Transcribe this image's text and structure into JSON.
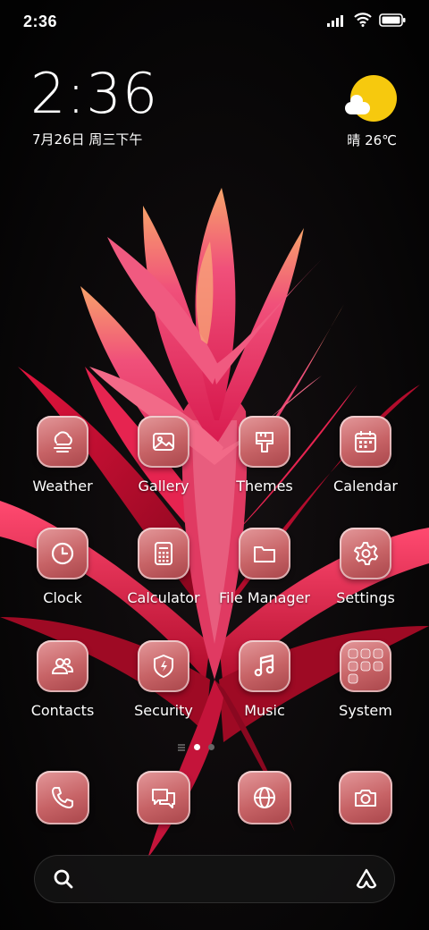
{
  "status_bar": {
    "time": "2:36",
    "icons": [
      "signal-icon",
      "wifi-icon",
      "battery-icon"
    ]
  },
  "clock_widget": {
    "time": "2:36",
    "date": "7月26日 周三下午"
  },
  "weather_widget": {
    "icon": "partly-sunny-icon",
    "text": "晴 26℃",
    "sun_color": "#f6c90e"
  },
  "apps": [
    {
      "label": "Weather",
      "icon": "cloud-icon"
    },
    {
      "label": "Gallery",
      "icon": "image-icon"
    },
    {
      "label": "Themes",
      "icon": "paintbrush-icon"
    },
    {
      "label": "Calendar",
      "icon": "calendar-icon"
    },
    {
      "label": "Clock",
      "icon": "clock-icon"
    },
    {
      "label": "Calculator",
      "icon": "calculator-icon"
    },
    {
      "label": "File Manager",
      "icon": "folder-icon"
    },
    {
      "label": "Settings",
      "icon": "gear-icon"
    },
    {
      "label": "Contacts",
      "icon": "contacts-icon"
    },
    {
      "label": "Security",
      "icon": "shield-icon"
    },
    {
      "label": "Music",
      "icon": "music-note-icon"
    },
    {
      "label": "System",
      "icon": "folder-grid-icon"
    }
  ],
  "page_indicator": {
    "pages": 2,
    "current": 1
  },
  "dock": [
    {
      "icon": "phone-icon"
    },
    {
      "icon": "messages-icon"
    },
    {
      "icon": "browser-globe-icon"
    },
    {
      "icon": "camera-icon"
    }
  ],
  "search_bar": {
    "left_icon": "search-icon",
    "right_icon": "assistant-icon"
  },
  "theme": {
    "icon_tint": "#c76366",
    "wallpaper_accent": "#e8285a"
  }
}
